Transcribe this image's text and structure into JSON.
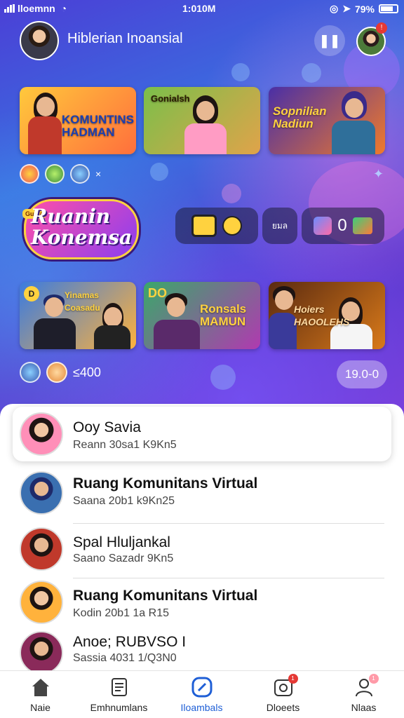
{
  "status_bar": {
    "carrier": "lloemnn",
    "time": "1:010M",
    "battery": "79%"
  },
  "header": {
    "title": "Hiblerian Inoansial",
    "pause_icon": "pause-icon",
    "notification_badge": "!"
  },
  "top_thumbnails": [
    {
      "title": "KOMUNTINS\nHADMAN",
      "colors": [
        "#ffc93c",
        "#ff6f3c"
      ]
    },
    {
      "title": "Gonialsh",
      "colors": [
        "#7bbf4a",
        "#e0a34a"
      ]
    },
    {
      "title": "Sopnilian\nNadiun",
      "colors": [
        "#4a2fa6",
        "#f07a2a"
      ]
    }
  ],
  "mini_close": "×",
  "logo": {
    "tag": "Gunla",
    "line1": "Ruanin",
    "line2": "Konemsa"
  },
  "pills": {
    "middle_label": "ยมล",
    "right_label": "0"
  },
  "bottom_thumbnails": [
    {
      "title": "Yinamas\nCoasadu",
      "colors": [
        "#3a7be0",
        "#ffb23c"
      ]
    },
    {
      "title": "Ronsals\nMAMUN",
      "colors": [
        "#3aa86a",
        "#b03ab0"
      ]
    },
    {
      "title": "Hoiers\nHAOOLEHS",
      "colors": [
        "#5a2a10",
        "#d97a1a"
      ]
    }
  ],
  "thumb_extras": {
    "left_badge": "D",
    "middle_badge": "DO"
  },
  "stats": {
    "left_count": "≤400",
    "right_count": "19.0-0"
  },
  "list": [
    {
      "title": "Ooy Savia",
      "subtitle": "Reann 30sa1 K9Kn5",
      "bold": false
    },
    {
      "title": "Ruang Komunitans Virtual",
      "subtitle": "Saana 20b1 k9Kn25",
      "bold": true
    },
    {
      "title": "Spal Hluljankal",
      "subtitle": "Saano Sazadr 9Kn5",
      "bold": false
    },
    {
      "title": "Ruang Komunitans Virtual",
      "subtitle": "Kodin 20b1 1a R15",
      "bold": true
    },
    {
      "title": "Anoe; RUBVSO I",
      "subtitle": "Sassia 4031 1/Q3N0",
      "bold": false
    }
  ],
  "nav": [
    {
      "label": "Naie",
      "icon": "home-icon"
    },
    {
      "label": "Emhnumlans",
      "icon": "document-icon"
    },
    {
      "label": "Iloambals",
      "icon": "compass-icon",
      "active": true
    },
    {
      "label": "Dloeets",
      "icon": "badge-icon",
      "badge": "1"
    },
    {
      "label": "Nlaas",
      "icon": "profile-icon",
      "badge": "1"
    }
  ],
  "colors": {
    "accent": "#1f5fd6",
    "badge": "#e53935"
  }
}
